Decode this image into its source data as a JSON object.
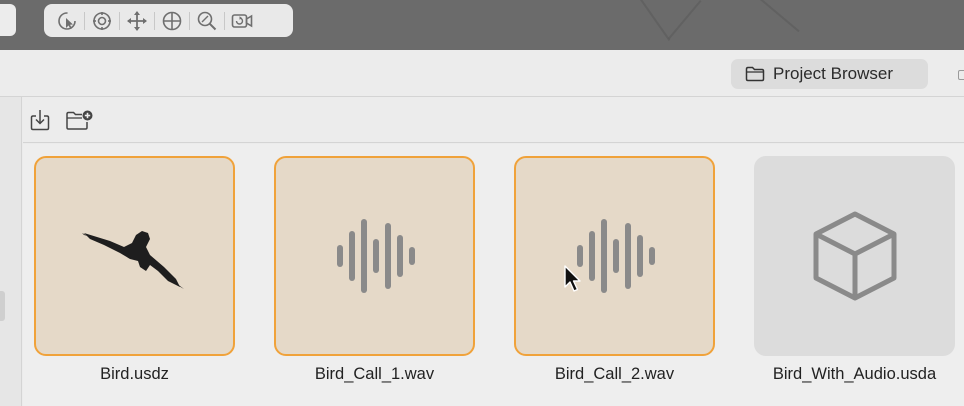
{
  "viewport_toolbar": {
    "tools": [
      {
        "icon": "select-arrow-icon"
      },
      {
        "icon": "orbit-icon"
      },
      {
        "icon": "move-icon"
      },
      {
        "icon": "globe-icon"
      },
      {
        "icon": "zoom-icon"
      },
      {
        "icon": "camera-reset-icon"
      }
    ]
  },
  "header": {
    "project_browser_label": "Project Browser",
    "project_browser_icon": "folder-icon"
  },
  "browser_toolbar": {
    "import_icon": "import-icon",
    "new_folder_icon": "new-folder-icon"
  },
  "assets": [
    {
      "name": "Bird.usdz",
      "kind": "model-preview",
      "selected": true
    },
    {
      "name": "Bird_Call_1.wav",
      "kind": "audio",
      "selected": true
    },
    {
      "name": "Bird_Call_2.wav",
      "kind": "audio",
      "selected": true
    },
    {
      "name": "Bird_With_Audio.usda",
      "kind": "scene",
      "selected": false
    }
  ],
  "colors": {
    "selection_border": "#f0a23a",
    "selection_fill": "#e5d9c8",
    "icon_gray": "#8a8a8a"
  }
}
